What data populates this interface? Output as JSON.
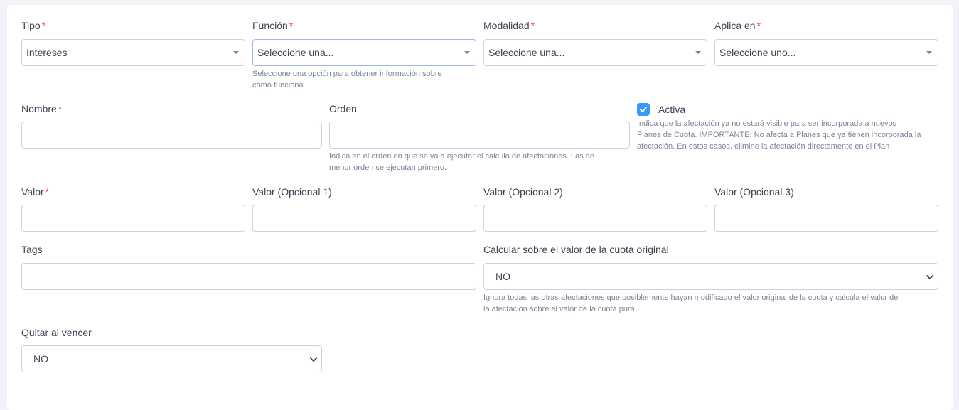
{
  "form": {
    "required_mark": "*",
    "tipo": {
      "label": "Tipo",
      "value": "Intereses"
    },
    "funcion": {
      "label": "Función",
      "placeholder": "Seleccione una...",
      "help_line1": "Seleccione una opción para obtener información sobre",
      "help_line2": "cómo funciona"
    },
    "modalidad": {
      "label": "Modalidad",
      "placeholder": "Seleccione una..."
    },
    "aplica_en": {
      "label": "Aplica en",
      "placeholder": "Seleccione uno..."
    },
    "nombre": {
      "label": "Nombre",
      "value": ""
    },
    "orden": {
      "label": "Orden",
      "value": "",
      "help_line1": "Indica en el orden en que se va a ejecutar el cálculo de afectaciones. Las de",
      "help_line2": "menor orden se ejecutan primero."
    },
    "activa": {
      "label": "Activa",
      "checked": true,
      "help_line1": "Indica que la afectación ya no estará visible para ser incorporada a nuevos",
      "help_line2": "Planes de Cuota. IMPORTANTE: No afecta a Planes que ya tienen incorporada la",
      "help_line3": "afectación. En estos casos, elimine la afectación directamente en el Plan"
    },
    "valor": {
      "label": "Valor",
      "value": ""
    },
    "valor_op1": {
      "label": "Valor (Opcional 1)",
      "value": ""
    },
    "valor_op2": {
      "label": "Valor (Opcional 2)",
      "value": ""
    },
    "valor_op3": {
      "label": "Valor (Opcional 3)",
      "value": ""
    },
    "tags": {
      "label": "Tags",
      "value": ""
    },
    "calcular": {
      "label": "Calcular sobre el valor de la cuota original",
      "value": "NO",
      "help_line1": "Ignora todas las otras afectaciones que posiblemente hayan modificado el valor original de la cuota y calcula el valor de",
      "help_line2": "la afectación sobre el valor de la cuota pura"
    },
    "quitar": {
      "label": "Quitar al vencer",
      "value": "NO"
    }
  },
  "colors": {
    "required": "#f64e60",
    "checkbox": "#3699ff",
    "border": "#cfd2dc"
  }
}
